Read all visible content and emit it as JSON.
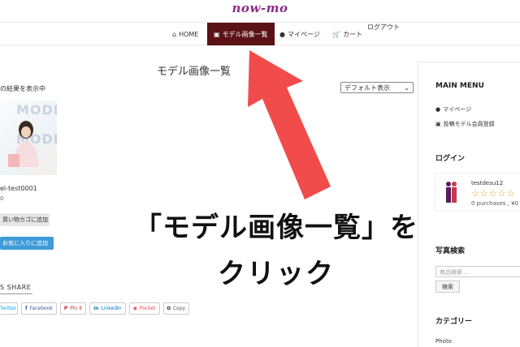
{
  "site": {
    "logo": "now-mo"
  },
  "nav": {
    "items": [
      {
        "label": "HOME",
        "icon": "home-icon"
      },
      {
        "label": "モデル画像一覧",
        "icon": "image-icon"
      },
      {
        "label": "マイページ",
        "icon": "user-icon"
      },
      {
        "label": "カート",
        "icon": "cart-icon"
      }
    ],
    "logout": "ログアウト",
    "active_color": "#5a1216"
  },
  "main": {
    "title": "モデル画像一覧",
    "results_text": "の結果を表示中",
    "sort_select": {
      "value": "デフォルト表示"
    },
    "item": {
      "watermark": "MODE",
      "name": "el-test0001",
      "price": "0",
      "cart_button": "買い物カゴに追加",
      "favorite_button": "お気に入りに追加"
    },
    "share": {
      "label": "S SHARE",
      "buttons": [
        {
          "label": "Twitter",
          "icon": "twitter-icon",
          "color": "#1da1f2"
        },
        {
          "label": "Facebook",
          "icon": "facebook-icon",
          "color": "#3b5998"
        },
        {
          "label": "Pin it",
          "icon": "pinterest-icon",
          "color": "#cb2027"
        },
        {
          "label": "LinkedIn",
          "icon": "linkedin-icon",
          "color": "#0077b5"
        },
        {
          "label": "Pocket",
          "icon": "pocket-icon",
          "color": "#ef4056"
        },
        {
          "label": "Copy",
          "icon": "copy-icon",
          "color": "#555555"
        }
      ]
    }
  },
  "sidebar": {
    "main_menu_title": "MAIN MENU",
    "menu_items": [
      {
        "label": "マイページ",
        "icon": "user-icon"
      },
      {
        "label": "投稿モデル会員登録",
        "icon": "camera-icon"
      }
    ],
    "login_title": "ログイン",
    "login": {
      "username": "testdesu12",
      "stats": "0 purchases , ¥0"
    },
    "photo_search_title": "写真検索",
    "search": {
      "placeholder": "商品検索 …",
      "button": "検索"
    },
    "category_title": "カテゴリー",
    "category_first": "Photo"
  },
  "overlay": {
    "caption_line1": "「モデル画像一覧」を",
    "caption_line2": "クリック",
    "arrow_color": "#f24b4b"
  }
}
